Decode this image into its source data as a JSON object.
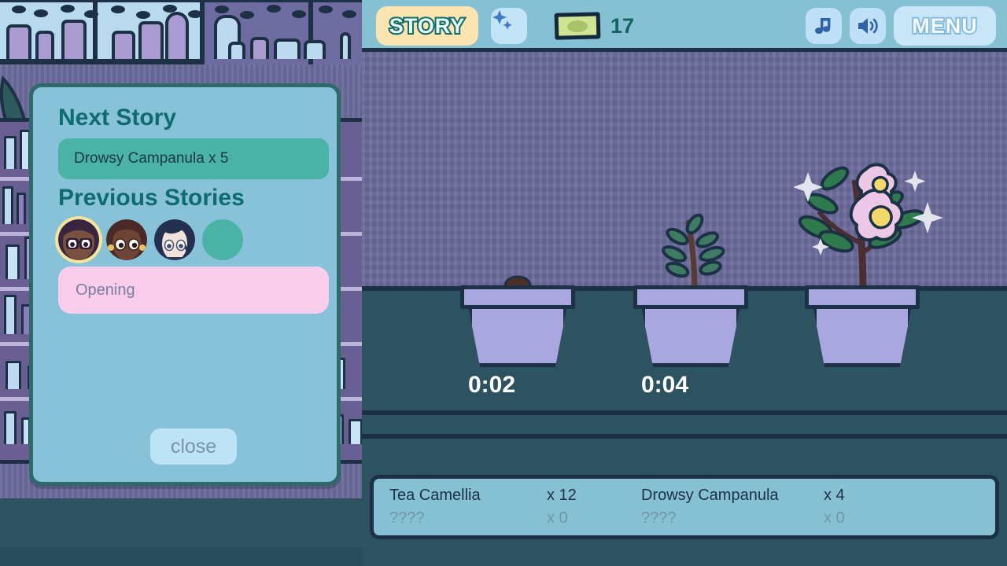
{
  "topbar": {
    "story_label": "STORY",
    "sparkle_icon": "sparkles-icon",
    "money_icon": "money-bill-icon",
    "money_value": "17",
    "music_icon": "music-note-icon",
    "sound_icon": "speaker-volume-icon",
    "menu_label": "MENU"
  },
  "dialog": {
    "next_story_title": "Next Story",
    "next_story_requirement": "Drowsy Campanula x 5",
    "previous_stories_title": "Previous Stories",
    "avatars": [
      {
        "name": "avatar-character-1",
        "selected": true
      },
      {
        "name": "avatar-character-2",
        "selected": false
      },
      {
        "name": "avatar-character-3",
        "selected": false
      },
      {
        "name": "avatar-empty-slot",
        "selected": false
      }
    ],
    "selected_story_label": "Opening",
    "close_label": "close"
  },
  "garden": {
    "pots": [
      {
        "slot": 1,
        "timer": "0:02",
        "stage": "sprout"
      },
      {
        "slot": 2,
        "timer": "0:04",
        "stage": "seedling"
      },
      {
        "slot": 3,
        "timer": "",
        "stage": "bloomed"
      }
    ]
  },
  "inventory": {
    "rows": [
      [
        {
          "name": "Tea Camellia",
          "qty": "x 12"
        },
        {
          "name": "Drowsy Campanula",
          "qty": "x 4"
        }
      ],
      [
        {
          "name": "????",
          "qty": "x 0"
        },
        {
          "name": "????",
          "qty": "x 0"
        }
      ]
    ]
  },
  "colors": {
    "outline": "#1c3046",
    "counter": "#2d5260",
    "wall": "#6b6a9c",
    "topbar": "#86c0d3",
    "dialog_body": "#88c2d8",
    "dialog_border": "#2e6a6a",
    "accent_teal": "#0d6b71",
    "field_teal": "#4bb3a5",
    "pink_field": "#f9cdec",
    "story_badge": "#fce5b0",
    "pot": "#aaa6e0",
    "money_text": "#16625f"
  }
}
